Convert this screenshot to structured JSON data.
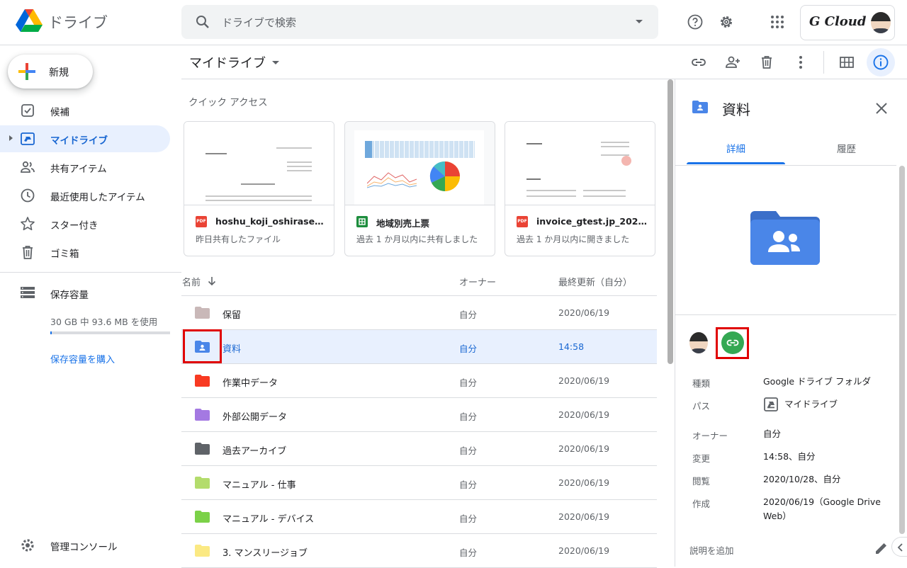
{
  "app": {
    "name": "ドライブ",
    "search_placeholder": "ドライブで検索",
    "account_brand": "G Cloud"
  },
  "sidebar": {
    "new_label": "新規",
    "items": [
      {
        "label": "候補",
        "icon": "checkbox-icon"
      },
      {
        "label": "マイドライブ",
        "icon": "my-drive-icon",
        "active": true
      },
      {
        "label": "共有アイテム",
        "icon": "shared-icon"
      },
      {
        "label": "最近使用したアイテム",
        "icon": "clock-icon"
      },
      {
        "label": "スター付き",
        "icon": "star-icon"
      },
      {
        "label": "ゴミ箱",
        "icon": "trash-icon"
      }
    ],
    "storage_label": "保存容量",
    "storage_usage": "30 GB 中 93.6 MB を使用",
    "storage_used_fraction": 0.003,
    "buy_storage": "保存容量を購入",
    "admin_console": "管理コンソール"
  },
  "main": {
    "breadcrumb": "マイドライブ",
    "quick_access_title": "クイック アクセス",
    "quick_access": [
      {
        "name": "hoshu_koji_oshirase01.…",
        "sub": "昨日共有したファイル",
        "type": "pdf"
      },
      {
        "name": "地域別売上票",
        "sub": "過去 1 か月以内に共有しました",
        "type": "sheet"
      },
      {
        "name": "invoice_gtest.jp_202010…",
        "sub": "過去 1 か月以内に開きました",
        "type": "pdf"
      }
    ],
    "pdf_badge": "PDF",
    "columns": {
      "name": "名前",
      "owner": "オーナー",
      "modified": "最終更新（自分）"
    },
    "rows": [
      {
        "name": "保留",
        "owner": "自分",
        "modified": "2020/06/19",
        "color": "#c9b8b8"
      },
      {
        "name": "資料",
        "owner": "自分",
        "modified": "14:58",
        "color": "#4a86e8",
        "selected": true
      },
      {
        "name": "作業中データ",
        "owner": "自分",
        "modified": "2020/06/19",
        "color": "#f83a22"
      },
      {
        "name": "外部公開データ",
        "owner": "自分",
        "modified": "2020/06/19",
        "color": "#a479e2"
      },
      {
        "name": "過去アーカイブ",
        "owner": "自分",
        "modified": "2020/06/19",
        "color": "#5f6368"
      },
      {
        "name": "マニュアル - 仕事",
        "owner": "自分",
        "modified": "2020/06/19",
        "color": "#b3dc6c"
      },
      {
        "name": "マニュアル - デバイス",
        "owner": "自分",
        "modified": "2020/06/19",
        "color": "#7bd148"
      },
      {
        "name": "3. マンスリージョブ",
        "owner": "自分",
        "modified": "2020/06/19",
        "color": "#fbe983"
      }
    ]
  },
  "panel": {
    "title": "資料",
    "tab_details": "詳細",
    "tab_activity": "履歴",
    "details": [
      {
        "key": "種類",
        "value": "Google ドライブ フォルダ"
      },
      {
        "key": "パス",
        "value": "マイドライブ"
      },
      {
        "key": "オーナー",
        "value": "自分"
      },
      {
        "key": "変更",
        "value": "14:58、自分"
      },
      {
        "key": "閲覧",
        "value": "2020/10/28、自分"
      },
      {
        "key": "作成",
        "value": "2020/06/19（Google Drive Web）"
      }
    ],
    "add_description": "説明を追加"
  },
  "colors": {
    "accent": "#1a73e8",
    "selected_bg": "#e8f0fe",
    "link_share": "#34a853",
    "highlight_box": "#e00000"
  }
}
